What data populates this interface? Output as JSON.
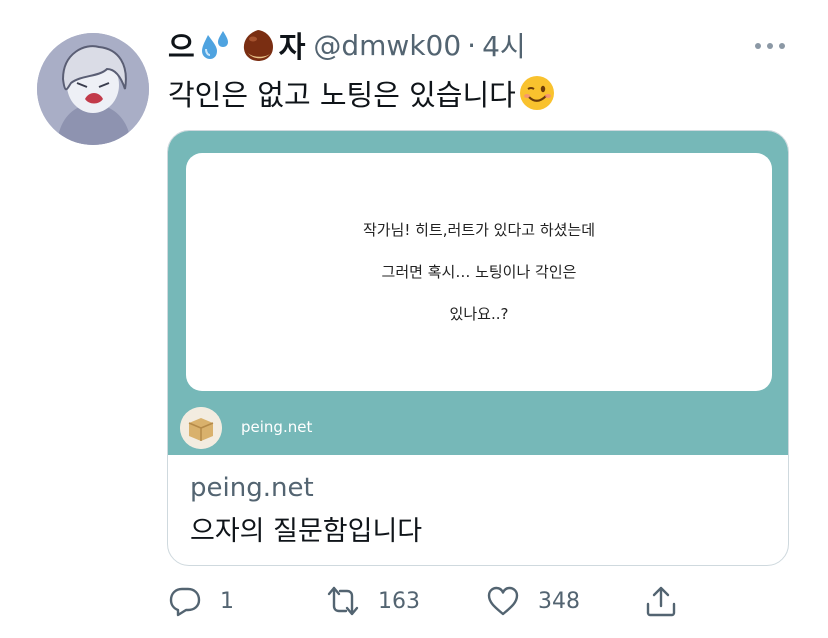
{
  "tweet": {
    "display_name_part1": "으",
    "display_name_part2": "자",
    "handle": "@dmwk00",
    "separator": "·",
    "time": "4시",
    "text": "각인은 없고 노팅은 있습니다",
    "emojis": [
      "sweat-droplets-emoji",
      "chestnut-emoji",
      "winking-face-emoji"
    ]
  },
  "card": {
    "question_lines": [
      "작가님! 히트,러트가 있다고 하셨는데",
      "그러면 혹시… 노팅이나 각인은",
      "있나요..?"
    ],
    "image_domain": "peing.net",
    "domain": "peing.net",
    "title": "으자의 질문함입니다",
    "colors": {
      "accent": "#76b8b8"
    }
  },
  "actions": {
    "reply_count": "1",
    "retweet_count": "163",
    "like_count": "348"
  },
  "colors": {
    "secondary_text": "#536471",
    "border": "#cfd9de"
  }
}
